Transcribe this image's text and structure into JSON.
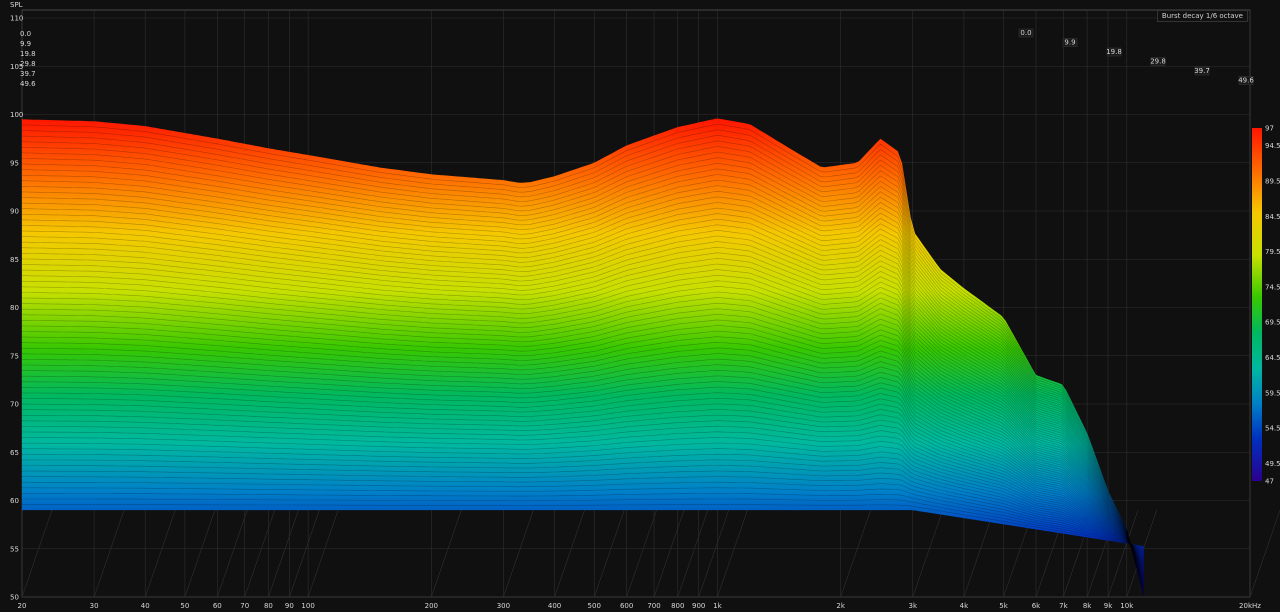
{
  "chart_data": {
    "type": "area",
    "title": "Burst decay 1/6 octave",
    "ylabel": "SPL",
    "xlabel": "",
    "x_tick_labels": [
      "20",
      "30",
      "40",
      "50",
      "60",
      "70",
      "80",
      "90",
      "100",
      "200",
      "300",
      "400",
      "500",
      "600",
      "700",
      "800",
      "900",
      "1k",
      "2k",
      "3k",
      "4k",
      "5k",
      "6k",
      "7k",
      "8k",
      "9k",
      "10k",
      "20kHz"
    ],
    "x_tick_values": [
      20,
      30,
      40,
      50,
      60,
      70,
      80,
      90,
      100,
      200,
      300,
      400,
      500,
      600,
      700,
      800,
      900,
      1000,
      2000,
      3000,
      4000,
      5000,
      6000,
      7000,
      8000,
      9000,
      10000,
      20000
    ],
    "xlim": [
      20,
      20000
    ],
    "x_scale": "log",
    "y_tick_labels": [
      "110",
      "105",
      "100",
      "95",
      "90",
      "85",
      "80",
      "75",
      "70",
      "65",
      "60",
      "55",
      "50"
    ],
    "y_tick_values": [
      110,
      105,
      100,
      95,
      90,
      85,
      80,
      75,
      70,
      65,
      60,
      55,
      50
    ],
    "ylim": [
      50,
      110
    ],
    "z_tick_labels": [
      "0.0",
      "9.9",
      "19.8",
      "29.8",
      "39.7",
      "49.6"
    ],
    "z_tick_values": [
      0.0,
      9.9,
      19.8,
      29.8,
      39.7,
      49.6
    ],
    "colorbar_labels": [
      "97",
      "94.5",
      "89.5",
      "84.5",
      "79.5",
      "74.5",
      "69.5",
      "64.5",
      "59.5",
      "54.5",
      "49.5",
      "47"
    ],
    "colorbar_values": [
      97,
      94.5,
      89.5,
      84.5,
      79.5,
      74.5,
      69.5,
      64.5,
      59.5,
      54.5,
      49.5,
      47
    ],
    "colorbar_range": [
      47,
      97
    ],
    "front_curve": {
      "frequencies": [
        20,
        30,
        40,
        60,
        80,
        100,
        150,
        200,
        300,
        330,
        350,
        400,
        500,
        600,
        800,
        1000,
        1200,
        1500,
        1800,
        2200,
        2500,
        2800,
        3000,
        3500,
        4000,
        5000,
        6000,
        7000,
        8000,
        9000,
        10000,
        11000
      ],
      "spl": [
        99.5,
        99.3,
        98.8,
        97.5,
        96.5,
        95.8,
        94.5,
        93.8,
        93.2,
        92.9,
        93.0,
        93.6,
        95.0,
        96.8,
        98.7,
        99.6,
        99.0,
        96.5,
        94.5,
        95.0,
        97.5,
        96.0,
        88.0,
        84.0,
        82.0,
        79.0,
        73.0,
        72.0,
        67.0,
        61.0,
        57.0,
        50.0
      ]
    },
    "decay_floor_spl": 59
  }
}
